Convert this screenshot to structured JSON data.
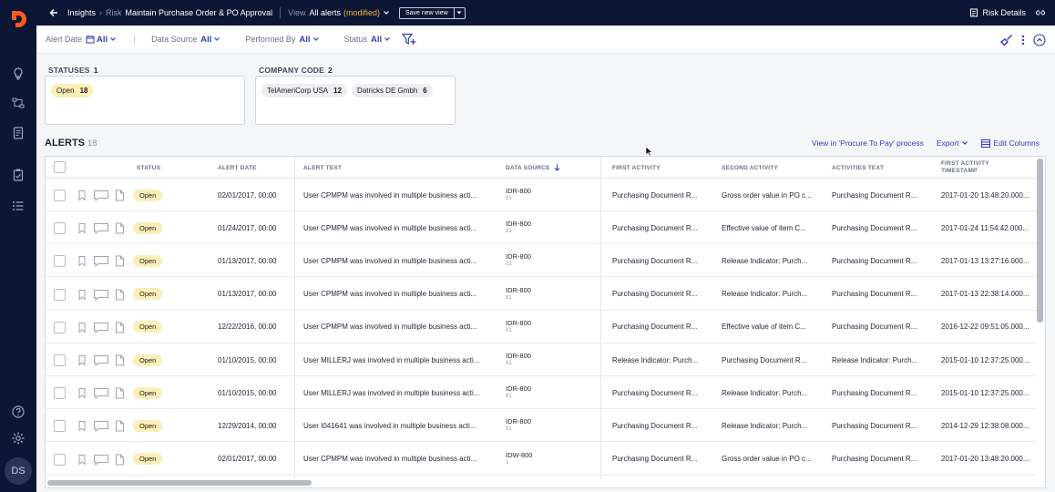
{
  "rail": {
    "avatar": "DS"
  },
  "topbar": {
    "crumb": "Insights",
    "crumb2": "Risk",
    "title": "Maintain Purchase Order & PO Approval",
    "view_label": "View",
    "view_value": "All alerts",
    "view_modified": "(modified)",
    "save_button": "Save new view",
    "risk_details": "Risk Details"
  },
  "filters": [
    {
      "label": "Alert Date",
      "value": "All"
    },
    {
      "label": "Data Source",
      "value": "All"
    },
    {
      "label": "Performed By",
      "value": "All"
    },
    {
      "label": "Status",
      "value": "All"
    }
  ],
  "summary": {
    "statuses": {
      "label": "STATUSES",
      "count": "1",
      "chips": [
        {
          "name": "Open",
          "count": "18"
        }
      ]
    },
    "company": {
      "label": "COMPANY CODE",
      "count": "2",
      "chips": [
        {
          "name": "TelAmeriCorp USA",
          "count": "12"
        },
        {
          "name": "Datricks DE Gmbh",
          "count": "6"
        }
      ]
    }
  },
  "alerts": {
    "title": "ALERTS",
    "count": "18",
    "view_process": "View in 'Procure To Pay' process",
    "export": "Export",
    "edit_columns": "Edit Columns"
  },
  "table": {
    "headers": {
      "status": "STATUS",
      "alert_date": "ALERT DATE",
      "alert_text": "ALERT TEXT",
      "data_source": "DATA SOURCE",
      "first_activity": "FIRST ACTIVITY",
      "second_activity": "SECOND ACTIVITY",
      "activities_text": "ACTIVITIES TEXT",
      "first_ts_1": "FIRST ACTIVITY",
      "first_ts_2": "TIMESTAMP"
    },
    "rows": [
      {
        "status": "Open",
        "date": "02/01/2017, 00:00",
        "text": "User CPMPM was involved in multiple business acti...",
        "ds": "IDR-800",
        "ds2": "81",
        "first": "Purchasing Document R...",
        "second": "Gross order value in PO c...",
        "acts": "Purchasing Document R...",
        "ts": "2017-01-20 13:48:20.000..."
      },
      {
        "status": "Open",
        "date": "01/24/2017, 00:00",
        "text": "User CPMPM was involved in multiple business acti...",
        "ds": "IDR-800",
        "ds2": "81",
        "first": "Purchasing Document R...",
        "second": "Effective value of item C...",
        "acts": "Purchasing Document R...",
        "ts": "2017-01-24 11:54:42.000..."
      },
      {
        "status": "Open",
        "date": "01/13/2017, 00:00",
        "text": "User CPMPM was involved in multiple business acti...",
        "ds": "IDR-800",
        "ds2": "81",
        "first": "Purchasing Document R...",
        "second": "Release Indicator: Purch...",
        "acts": "Purchasing Document R...",
        "ts": "2017-01-13 13:27:16.000..."
      },
      {
        "status": "Open",
        "date": "01/13/2017, 00:00",
        "text": "User CPMPM was involved in multiple business acti...",
        "ds": "IDR-800",
        "ds2": "81",
        "first": "Purchasing Document R...",
        "second": "Release Indicator: Purch...",
        "acts": "Purchasing Document R...",
        "ts": "2017-01-13 22:38:14.000..."
      },
      {
        "status": "Open",
        "date": "12/22/2016, 00:00",
        "text": "User CPMPM was involved in multiple business acti...",
        "ds": "IDR-800",
        "ds2": "81",
        "first": "Purchasing Document R...",
        "second": "Effective value of item C...",
        "acts": "Purchasing Document R...",
        "ts": "2016-12-22 09:51:05.000..."
      },
      {
        "status": "Open",
        "date": "01/10/2015, 00:00",
        "text": "User MILLERJ was involved in multiple business acti...",
        "ds": "IDR-800",
        "ds2": "81",
        "first": "Release Indicator: Purch...",
        "second": "Purchasing Document R...",
        "acts": "Release Indicator: Purch...",
        "ts": "2015-01-10 12:37:25.000..."
      },
      {
        "status": "Open",
        "date": "01/10/2015, 00:00",
        "text": "User MILLERJ was involved in multiple business acti...",
        "ds": "IDR-800",
        "ds2": "81",
        "first": "Purchasing Document R...",
        "second": "Release Indicator: Purch...",
        "acts": "Purchasing Document R...",
        "ts": "2015-01-10 12:37:25.000..."
      },
      {
        "status": "Open",
        "date": "12/29/2014, 00:00",
        "text": "User I041641 was involved in multiple business acti...",
        "ds": "IDR-800",
        "ds2": "81",
        "first": "Purchasing Document R...",
        "second": "Release Indicator: Purch...",
        "acts": "Purchasing Document R...",
        "ts": "2014-12-29 12:38:08.000..."
      },
      {
        "status": "Open",
        "date": "02/01/2017, 00:00",
        "text": "User CPMPM was involved in multiple business acti...",
        "ds": "IDW-800",
        "ds2": "1",
        "first": "Purchasing Document R...",
        "second": "Gross order value in PO c...",
        "acts": "Purchasing Document R...",
        "ts": "2017-01-20 13:48:20.000..."
      }
    ]
  },
  "colors": {
    "nav": "#0c1635",
    "accent": "#2f3fb8",
    "open_badge": "#fbeeb6",
    "logo": "#ff5a1f"
  }
}
